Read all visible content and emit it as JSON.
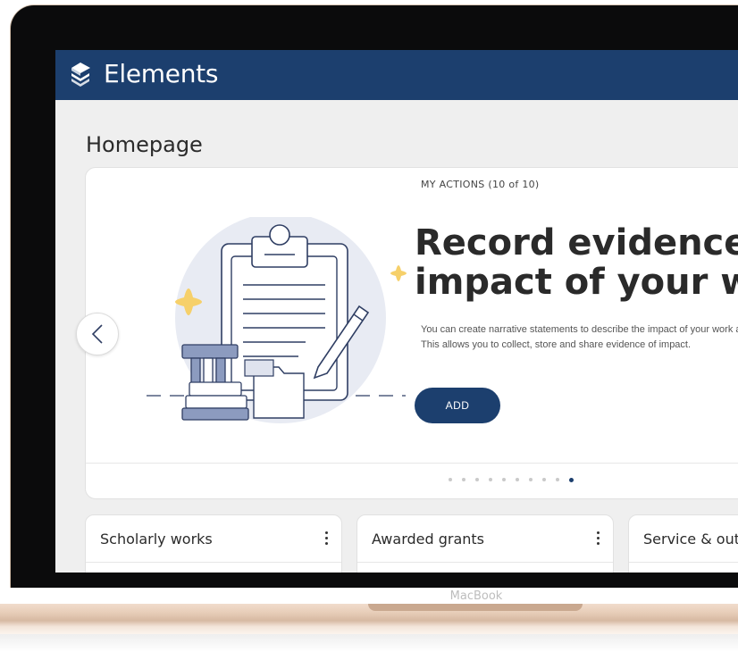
{
  "app": {
    "name": "Elements",
    "brand_color": "#1c3f6e",
    "logo_icon": "elements-logo-icon"
  },
  "page": {
    "title": "Homepage"
  },
  "carousel": {
    "actions_label": "MY ACTIONS (10 of 10)",
    "headline": "Record evidence of the impact of your work",
    "description": "You can create narrative statements to describe the impact of your work and attach files as supporting evidence. This allows you to collect, store and share evidence of impact.",
    "add_label": "ADD",
    "prev_icon": "chevron-left-icon",
    "total_slides": 10,
    "current_slide": 10
  },
  "widgets": [
    {
      "title": "Scholarly works",
      "menu_icon": "more-vertical-icon"
    },
    {
      "title": "Awarded grants",
      "menu_icon": "more-vertical-icon"
    },
    {
      "title": "Service & outreach",
      "menu_icon": "more-vertical-icon"
    }
  ],
  "device": {
    "label": "MacBook"
  }
}
